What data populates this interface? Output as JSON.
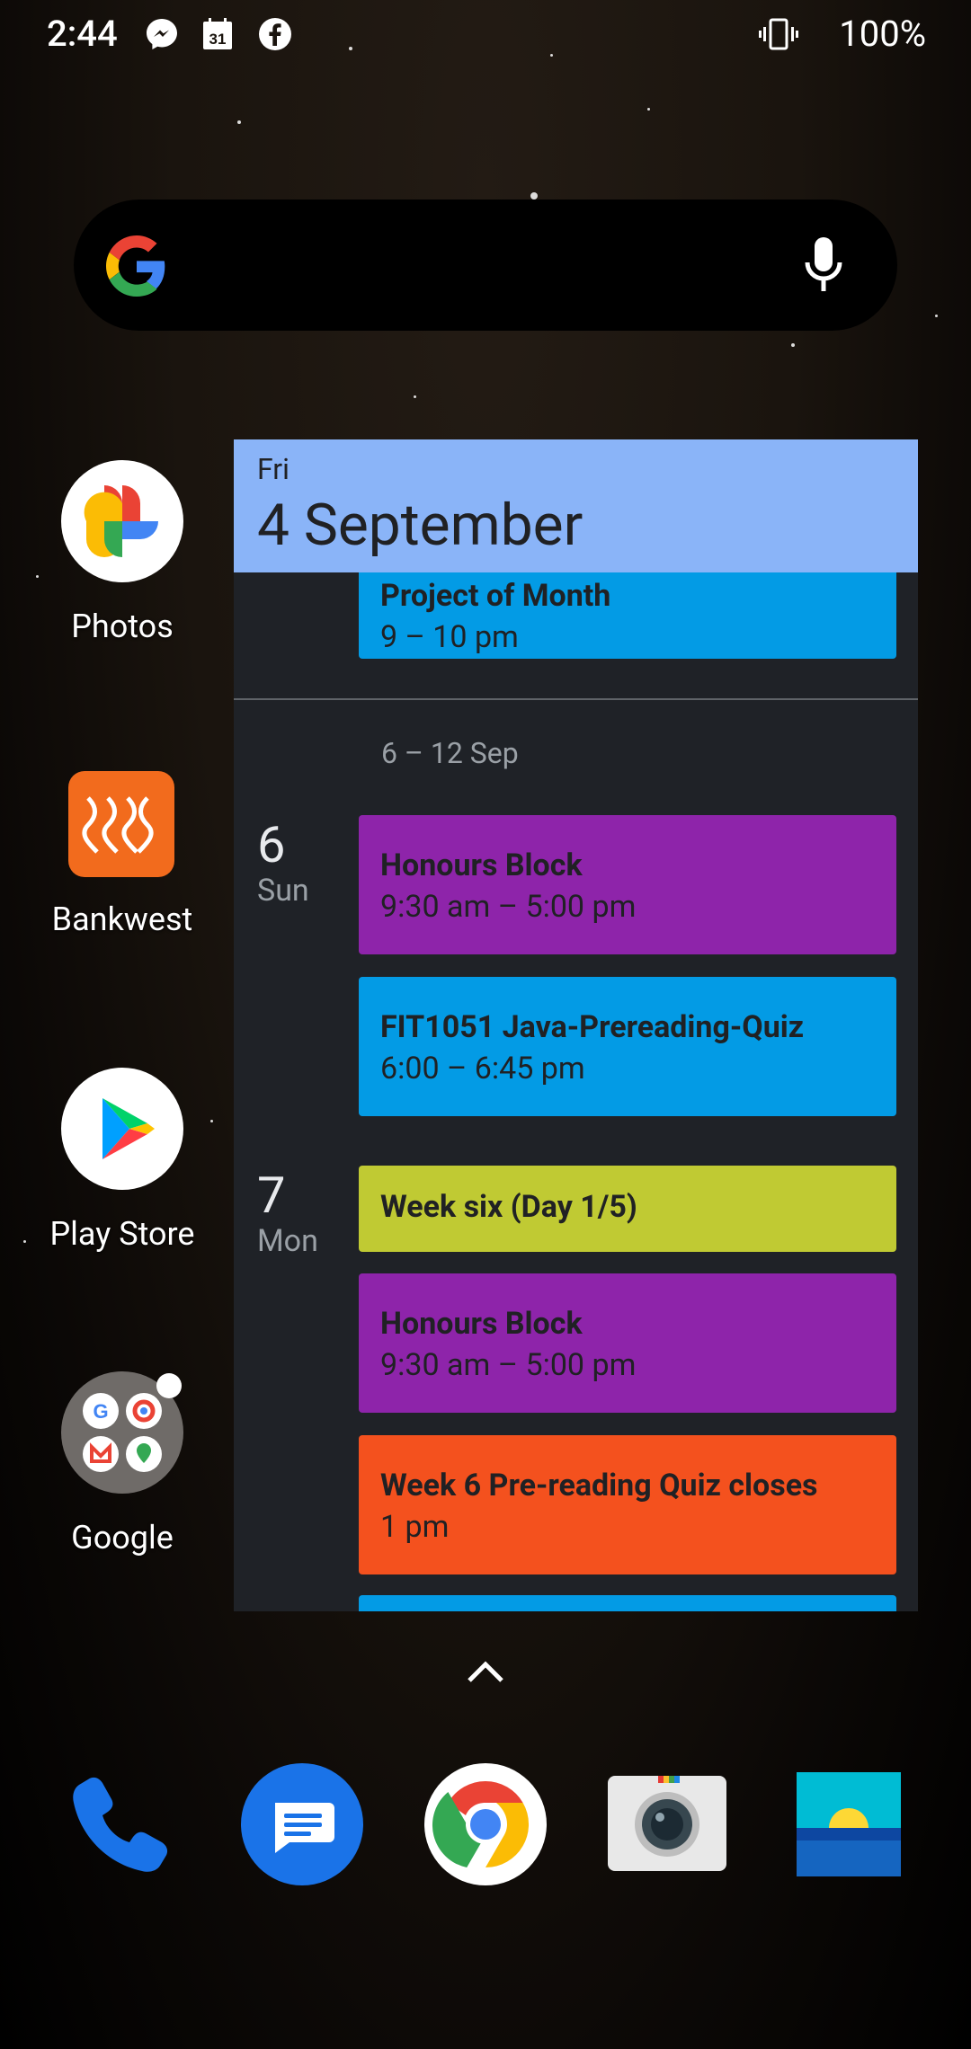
{
  "status_bar": {
    "time": "2:44",
    "battery": "100%",
    "icons": [
      "messenger-icon",
      "calendar-31-icon",
      "facebook-icon",
      "vibrate-icon"
    ]
  },
  "search": {
    "icons": [
      "google-g-icon",
      "microphone-icon"
    ]
  },
  "apps": [
    {
      "label": "Photos",
      "icon": "photos-icon"
    },
    {
      "label": "Bankwest",
      "icon": "bankwest-icon"
    },
    {
      "label": "Play Store",
      "icon": "play-store-icon"
    },
    {
      "label": "Google",
      "icon": "google-folder-icon"
    }
  ],
  "calendar": {
    "header": {
      "day_of_week": "Fri",
      "date": "4 September"
    },
    "partial_event": {
      "title": "Project of Month",
      "time": "9 – 10 pm",
      "color": "#039be5"
    },
    "week_range": "6 – 12 Sep",
    "days": [
      {
        "num": "6",
        "name": "Sun",
        "events": [
          {
            "title": "Honours Block",
            "time": "9:30 am – 5:00 pm",
            "color": "#8e24aa"
          },
          {
            "title": "FIT1051 Java-Prereading-Quiz",
            "time": "6:00 – 6:45 pm",
            "color": "#039be5"
          }
        ]
      },
      {
        "num": "7",
        "name": "Mon",
        "events": [
          {
            "title": "Week six (Day 1/5)",
            "time": "",
            "color": "#c0ca33"
          },
          {
            "title": "Honours Block",
            "time": "9:30 am – 5:00 pm",
            "color": "#8e24aa"
          },
          {
            "title": "Week 6 Pre-reading Quiz closes",
            "time": "1 pm",
            "color": "#f4511e"
          }
        ]
      }
    ]
  },
  "dock": [
    {
      "icon": "phone-icon"
    },
    {
      "icon": "messages-icon"
    },
    {
      "icon": "chrome-icon"
    },
    {
      "icon": "camera-icon"
    },
    {
      "icon": "gallery-icon"
    }
  ]
}
